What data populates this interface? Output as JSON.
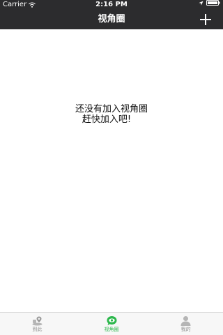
{
  "status_bar": {
    "carrier": "Carrier",
    "time": "2:16 PM",
    "wifi_icon": "wifi-icon",
    "location_icon": "location-arrow-icon",
    "battery_icon": "battery-icon"
  },
  "nav": {
    "title": "视角圈",
    "add_icon": "plus-icon"
  },
  "empty_state": {
    "line1": "还没有加入视角圈",
    "line2": "赶快加入吧!"
  },
  "tabs": [
    {
      "label": "到此",
      "icon": "map-pin-icon",
      "active": false
    },
    {
      "label": "视角圈",
      "icon": "eye-chat-icon",
      "active": true
    },
    {
      "label": "我的",
      "icon": "user-icon",
      "active": false
    }
  ],
  "colors": {
    "header_bg": "#2c2c2e",
    "accent": "#2db84d",
    "tab_inactive": "#8e8e8e",
    "tab_bar_bg": "#f7f7f7"
  }
}
